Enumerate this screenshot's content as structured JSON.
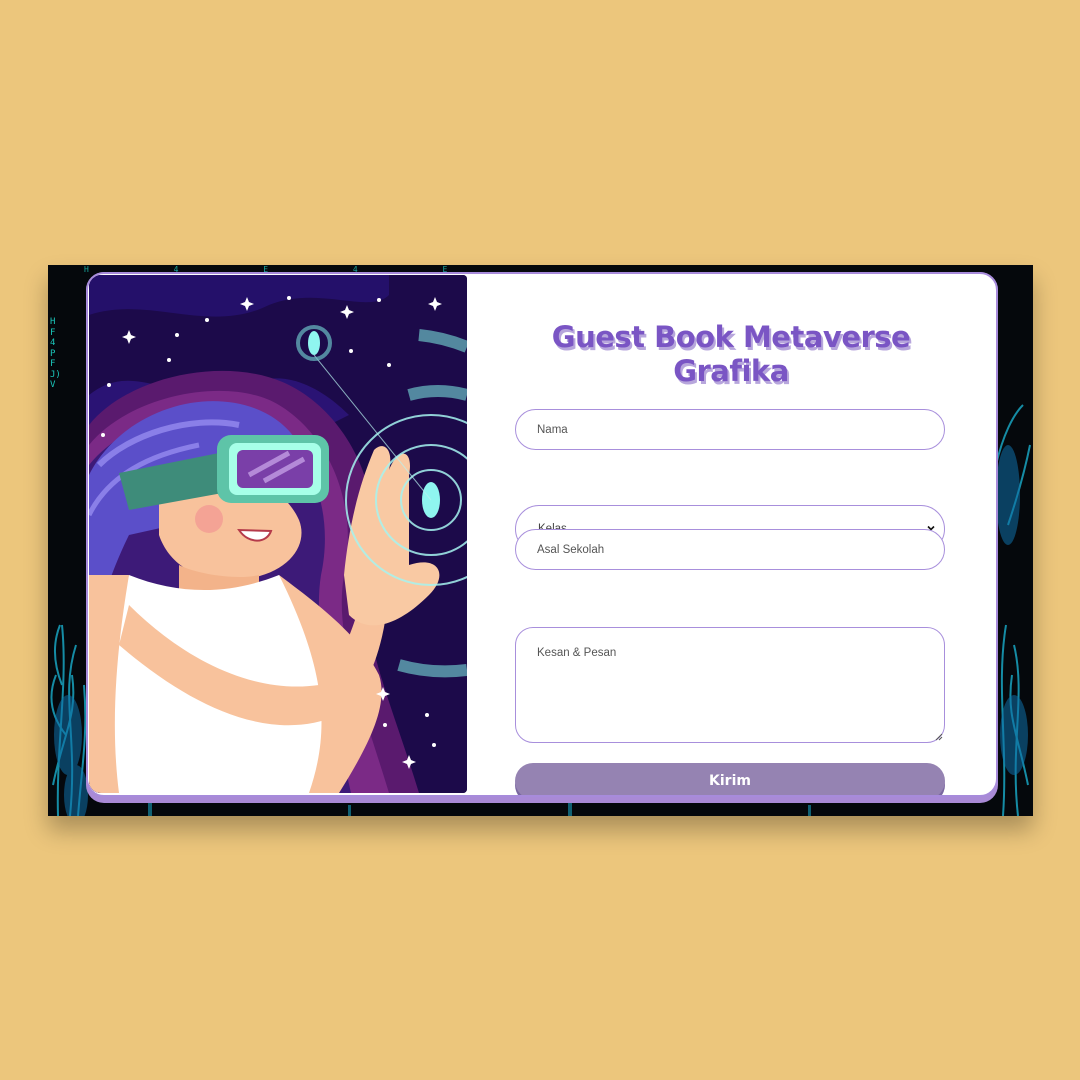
{
  "page": {
    "background_color": "#ecc67c",
    "accent_color": "#7a55c4",
    "matrix_color": "#1fe6d8"
  },
  "background": {
    "matrix_column": "HF4PFJ)V",
    "matrix_top": "H 4 E 4 E"
  },
  "illustration": {
    "icon": "vr-girl-hologram-illustration"
  },
  "form": {
    "title": "Guest Book Metaverse Grafika",
    "nama_placeholder": "Nama",
    "kelas_selected": "Kelas",
    "asal_sekolah_placeholder": "Asal Sekolah",
    "kesan_pesan_placeholder": "Kesan & Pesan",
    "submit_label": "Kirim"
  }
}
